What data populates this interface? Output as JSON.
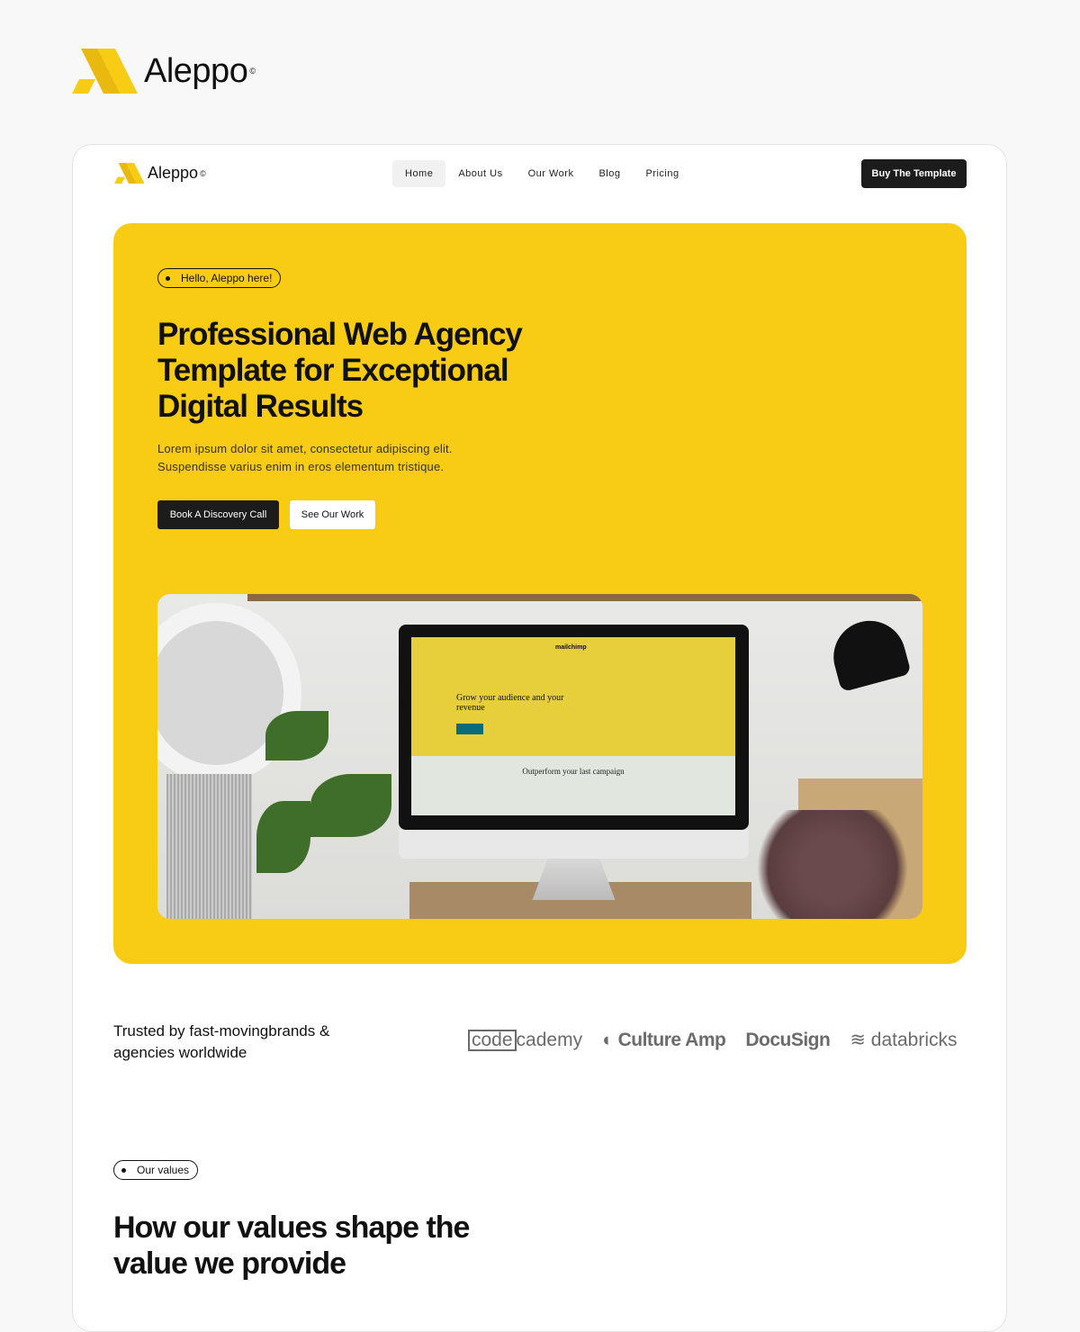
{
  "brand": {
    "name": "Aleppo",
    "mark": "©",
    "accent": "#F8CB14"
  },
  "nav": {
    "logo": "Aleppo",
    "items": [
      {
        "label": "Home",
        "active": true
      },
      {
        "label": "About Us"
      },
      {
        "label": "Our Work"
      },
      {
        "label": "Blog"
      },
      {
        "label": "Pricing"
      }
    ],
    "cta": "Buy The Template"
  },
  "hero": {
    "badge": "Hello, Aleppo here!",
    "title": "Professional Web Agency Template for Exceptional Digital Results",
    "subtitle_lines": [
      "Lorem ipsum dolor sit amet, consectetur adipiscing elit.",
      "Suspendisse varius enim in eros elementum tristique."
    ],
    "primary_button": "Book A Discovery Call",
    "secondary_button": "See Our Work",
    "image": {
      "screen_heading": "Grow your audience and your revenue",
      "screen_subheading": "Outperform your last campaign",
      "screen_brand": "mailchimp"
    }
  },
  "trusted": {
    "text": "Trusted by fast-movingbrands & agencies worldwide",
    "logos": [
      "codecademy",
      "Culture Amp",
      "DocuSign",
      "databricks"
    ]
  },
  "values": {
    "badge": "Our values",
    "title": "How our values shape the value we provide"
  }
}
